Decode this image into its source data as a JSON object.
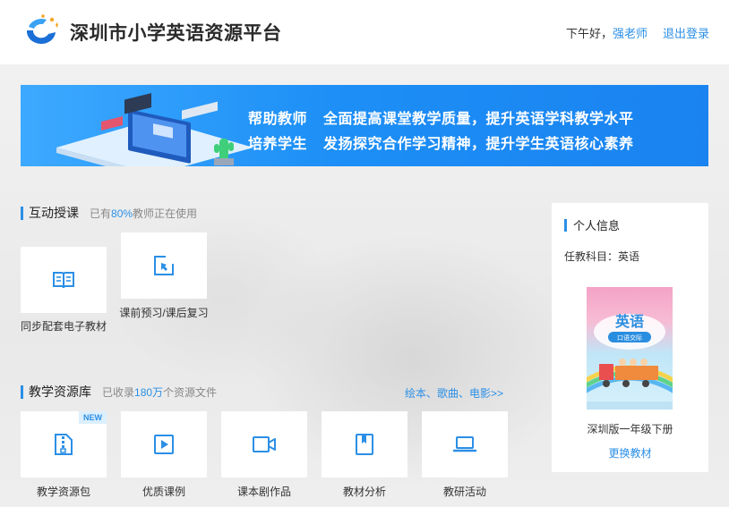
{
  "header": {
    "site_title": "深圳市小学英语资源平台",
    "greeting_prefix": "下午好，",
    "teacher_name": "强老师",
    "logout_label": "退出登录"
  },
  "banner": {
    "line1_lead": "帮助教师",
    "line1_text": "全面提高课堂教学质量，提升英语学科教学水平",
    "line2_lead": "培养学生",
    "line2_text": "发扬探究合作学习精神，提升学生英语核心素养"
  },
  "interactive": {
    "title": "互动授课",
    "sub_prefix": "已有",
    "sub_num": "80%",
    "sub_suffix": "教师正在使用",
    "tiles": [
      {
        "label": "同步配套电子教材",
        "icon": "open-book-icon"
      },
      {
        "label": "课前预习/课后复习",
        "icon": "cursor-select-icon"
      }
    ]
  },
  "library": {
    "title": "教学资源库",
    "sub_prefix": "已收录",
    "sub_num": "180万",
    "sub_suffix": "个资源文件",
    "more_link": "绘本、歌曲、电影>>",
    "tiles": [
      {
        "label": "教学资源包",
        "icon": "zip-file-icon",
        "badge": "NEW"
      },
      {
        "label": "优质课例",
        "icon": "video-play-icon"
      },
      {
        "label": "课本剧作品",
        "icon": "video-camera-icon"
      },
      {
        "label": "教材分析",
        "icon": "bookmark-book-icon"
      },
      {
        "label": "教研活动",
        "icon": "laptop-icon"
      }
    ]
  },
  "profile": {
    "title": "个人信息",
    "subject": "任教科目：英语",
    "book_title": "英语",
    "book_subtitle": "口语交际",
    "book_name": "深圳版一年级下册",
    "change_label": "更换教材"
  },
  "colors": {
    "accent": "#2b8fe6",
    "banner_start": "#3da9ff",
    "banner_end": "#1a83f0"
  }
}
